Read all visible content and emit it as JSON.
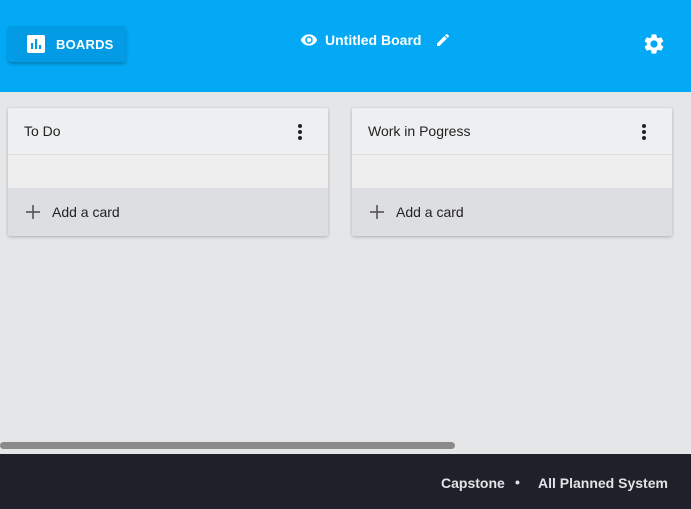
{
  "header": {
    "boards_label": "BOARDS",
    "board_title": "Untitled Board",
    "accent_color": "#03a9f4",
    "icons": {
      "boards": "bar-chart-icon",
      "visibility": "eye-icon",
      "edit": "pencil-icon",
      "settings": "gear-icon"
    }
  },
  "lists": [
    {
      "title": "To Do",
      "add_card_label": "Add a card"
    },
    {
      "title": "Work in Pogress",
      "add_card_label": "Add a card"
    }
  ],
  "footer": {
    "left_text": "Capstone",
    "separator": "•",
    "right_text": "All Planned System",
    "background_color": "#1f2029"
  }
}
